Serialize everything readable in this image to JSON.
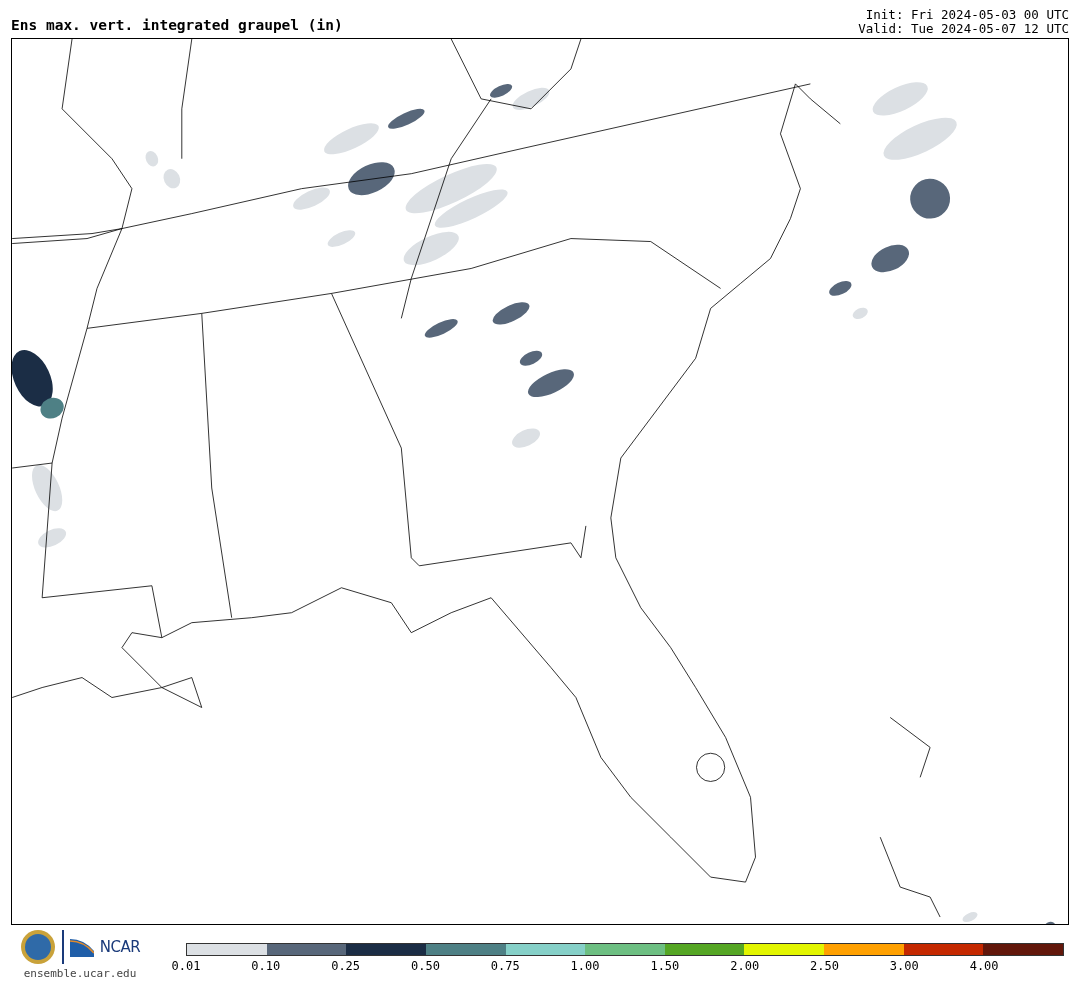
{
  "title": "Ens max. vert. integrated graupel (in)",
  "init": "Init: Fri 2024-05-03 00 UTC",
  "valid": "Valid: Tue 2024-05-07 12 UTC",
  "logo": {
    "text": "NCAR",
    "site": "ensemble.ucar.edu"
  },
  "colorbar": {
    "segments": [
      {
        "color": "#dce0e4",
        "label": "0.01"
      },
      {
        "color": "#58677a",
        "label": "0.10"
      },
      {
        "color": "#1b2d45",
        "label": "0.25"
      },
      {
        "color": "#4e8085",
        "label": "0.50"
      },
      {
        "color": "#86d0c8",
        "label": "0.75"
      },
      {
        "color": "#6dbf82",
        "label": "1.00"
      },
      {
        "color": "#55a624",
        "label": "1.50"
      },
      {
        "color": "#e2f500",
        "label": "2.00"
      },
      {
        "color": "#ffa000",
        "label": "2.50"
      },
      {
        "color": "#c42800",
        "label": "3.00"
      },
      {
        "color": "#62170b",
        "label": "4.00"
      }
    ]
  }
}
